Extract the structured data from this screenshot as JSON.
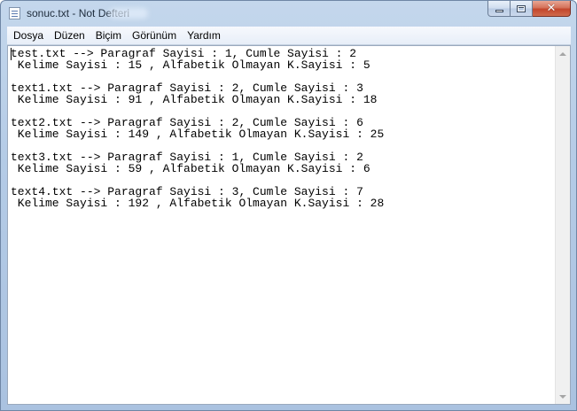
{
  "window": {
    "title": "sonuc.txt - Not Defteri",
    "icon": "notepad-icon",
    "controls": {
      "minimize": "minimize-icon",
      "maximize": "maximize-icon",
      "close": "close-icon",
      "close_glyph": "✕"
    },
    "accent_color": "#c3462c"
  },
  "menu": {
    "items": [
      {
        "label": "Dosya"
      },
      {
        "label": "Düzen"
      },
      {
        "label": "Biçim"
      },
      {
        "label": "Görünüm"
      },
      {
        "label": "Yardım"
      }
    ]
  },
  "editor": {
    "content": "test.txt --> Paragraf Sayisi : 1, Cumle Sayisi : 2\n Kelime Sayisi : 15 , Alfabetik Olmayan K.Sayisi : 5\n\ntext1.txt --> Paragraf Sayisi : 2, Cumle Sayisi : 3\n Kelime Sayisi : 91 , Alfabetik Olmayan K.Sayisi : 18\n\ntext2.txt --> Paragraf Sayisi : 2, Cumle Sayisi : 6\n Kelime Sayisi : 149 , Alfabetik Olmayan K.Sayisi : 25\n\ntext3.txt --> Paragraf Sayisi : 1, Cumle Sayisi : 2\n Kelime Sayisi : 59 , Alfabetik Olmayan K.Sayisi : 6\n\ntext4.txt --> Paragraf Sayisi : 3, Cumle Sayisi : 7\n Kelime Sayisi : 192 , Alfabetik Olmayan K.Sayisi : 28"
  },
  "scrollbar": {
    "up_icon": "scroll-up-arrow-icon",
    "down_icon": "scroll-down-arrow-icon"
  }
}
